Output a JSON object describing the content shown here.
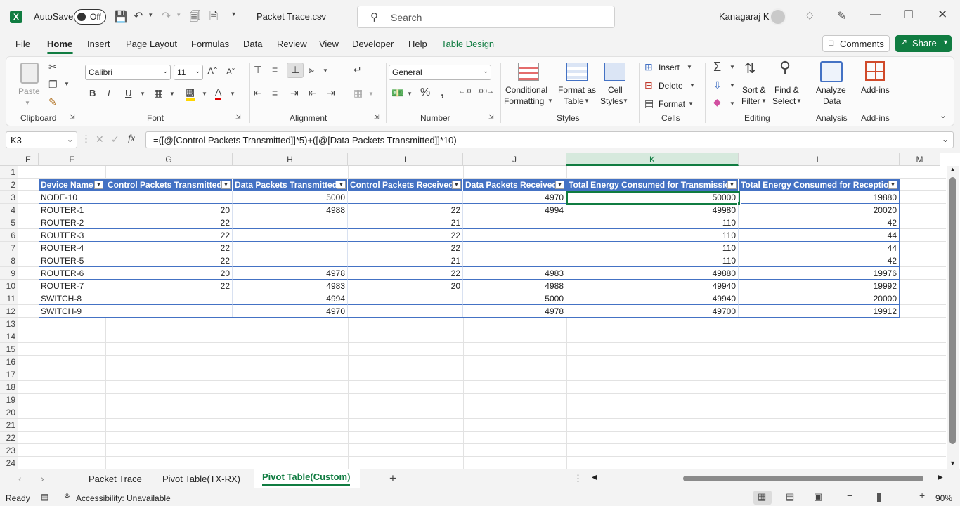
{
  "titlebar": {
    "autosave_label": "AutoSave",
    "autosave_state": "Off",
    "filename": "Packet Trace.csv",
    "search_placeholder": "Search",
    "user_name": "Kanagaraj K"
  },
  "tabs": [
    "File",
    "Home",
    "Insert",
    "Page Layout",
    "Formulas",
    "Data",
    "Review",
    "View",
    "Developer",
    "Help",
    "Table Design"
  ],
  "active_tab": "Home",
  "comments_label": "Comments",
  "share_label": "Share",
  "ribbon": {
    "clipboard": {
      "paste": "Paste",
      "label": "Clipboard"
    },
    "font": {
      "name": "Calibri",
      "size": "11",
      "label": "Font"
    },
    "alignment": {
      "label": "Alignment"
    },
    "number": {
      "format": "General",
      "label": "Number"
    },
    "styles": {
      "cond_fmt_1": "Conditional",
      "cond_fmt_2": "Formatting",
      "fmt_table_1": "Format as",
      "fmt_table_2": "Table",
      "cell_styles_1": "Cell",
      "cell_styles_2": "Styles",
      "label": "Styles"
    },
    "cells": {
      "insert": "Insert",
      "delete": "Delete",
      "format": "Format",
      "label": "Cells"
    },
    "editing": {
      "sort_1": "Sort &",
      "sort_2": "Filter",
      "find_1": "Find &",
      "find_2": "Select",
      "label": "Editing"
    },
    "analysis": {
      "analyze_1": "Analyze",
      "analyze_2": "Data",
      "label": "Analysis"
    },
    "addins": {
      "addins": "Add-ins",
      "label": "Add-ins"
    }
  },
  "formula_bar": {
    "name_box": "K3",
    "formula": "=([@[Control Packets Transmitted]]*5)+([@[Data Packets Transmitted]]*10)"
  },
  "columns": [
    "E",
    "F",
    "G",
    "H",
    "I",
    "J",
    "K",
    "L",
    "M"
  ],
  "selected_column": "K",
  "rows": [
    "1",
    "2",
    "3",
    "4",
    "5",
    "6",
    "7",
    "8",
    "9",
    "10",
    "11",
    "12",
    "13",
    "14",
    "15",
    "16",
    "17",
    "18",
    "19",
    "20",
    "21",
    "22",
    "23",
    "24"
  ],
  "table": {
    "headers": [
      "Device Name",
      "Control Packets Transmitted",
      "Data Packets Transmitted",
      "Control Packets Received",
      "Data Packets Received",
      "Total Energy Consumed for Transmission",
      "Total Energy Consumed for Reception"
    ],
    "rows": [
      [
        "NODE-10",
        "",
        "5000",
        "",
        "4970",
        "50000",
        "19880"
      ],
      [
        "ROUTER-1",
        "20",
        "4988",
        "22",
        "4994",
        "49980",
        "20020"
      ],
      [
        "ROUTER-2",
        "22",
        "",
        "21",
        "",
        "110",
        "42"
      ],
      [
        "ROUTER-3",
        "22",
        "",
        "22",
        "",
        "110",
        "44"
      ],
      [
        "ROUTER-4",
        "22",
        "",
        "22",
        "",
        "110",
        "44"
      ],
      [
        "ROUTER-5",
        "22",
        "",
        "21",
        "",
        "110",
        "42"
      ],
      [
        "ROUTER-6",
        "20",
        "4978",
        "22",
        "4983",
        "49880",
        "19976"
      ],
      [
        "ROUTER-7",
        "22",
        "4983",
        "20",
        "4988",
        "49940",
        "19992"
      ],
      [
        "SWITCH-8",
        "",
        "4994",
        "",
        "5000",
        "49940",
        "20000"
      ],
      [
        "SWITCH-9",
        "",
        "4970",
        "",
        "4978",
        "49700",
        "19912"
      ]
    ]
  },
  "sheets": [
    "Packet Trace",
    "Pivot Table(TX-RX)",
    "Pivot Table(Custom)"
  ],
  "active_sheet": "Pivot Table(Custom)",
  "status": {
    "ready": "Ready",
    "accessibility": "Accessibility: Unavailable",
    "zoom": "90%"
  },
  "colors": {
    "excel_green": "#107c41",
    "table_header": "#4472c4"
  }
}
